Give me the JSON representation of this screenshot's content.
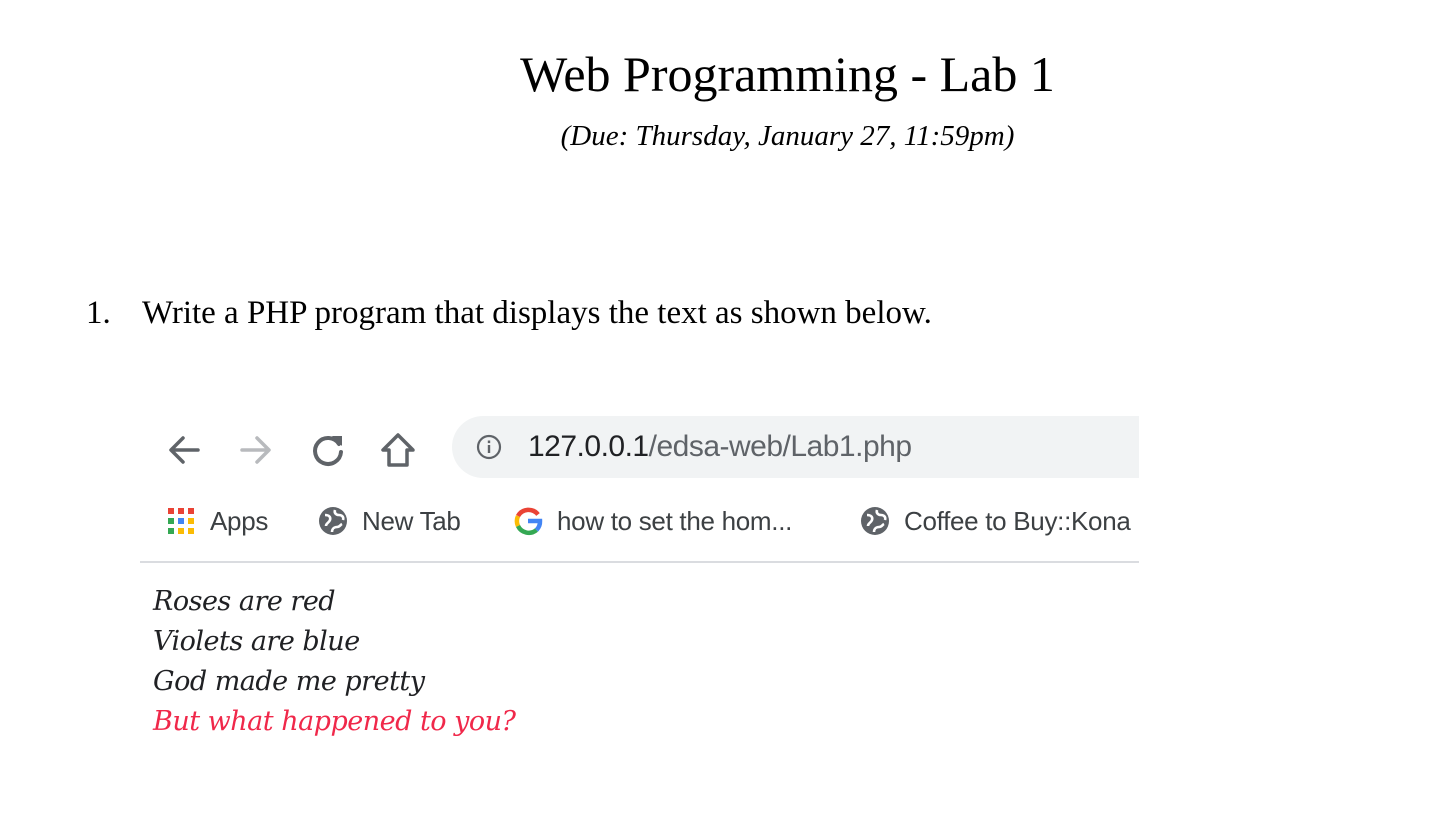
{
  "document": {
    "title": "Web Programming - Lab 1",
    "due": "(Due: Thursday, January 27, 11:59pm)",
    "questions": [
      {
        "number": "1.",
        "text": "Write a PHP program that displays the text as shown below."
      }
    ]
  },
  "browser_screenshot": {
    "nav": {
      "back_icon": "arrow-left-icon",
      "forward_icon": "arrow-right-icon",
      "reload_icon": "reload-icon",
      "home_icon": "home-icon"
    },
    "address_bar": {
      "info_icon": "info-icon",
      "url_host": "127.0.0.1",
      "url_path": "/edsa-web/Lab1.php"
    },
    "bookmarks": [
      {
        "icon": "apps-grid-icon",
        "label": "Apps"
      },
      {
        "icon": "globe-icon",
        "label": "New Tab"
      },
      {
        "icon": "google-g-icon",
        "label": "how to set the hom..."
      },
      {
        "icon": "globe-icon",
        "label": "Coffee to Buy::Kona"
      }
    ],
    "poem": [
      {
        "text": "Roses are red",
        "color": "#202124"
      },
      {
        "text": "Violets are blue",
        "color": "#202124"
      },
      {
        "text": "God made me pretty",
        "color": "#202124"
      },
      {
        "text": "But what happened to you?",
        "color": "#f0284a"
      }
    ]
  }
}
